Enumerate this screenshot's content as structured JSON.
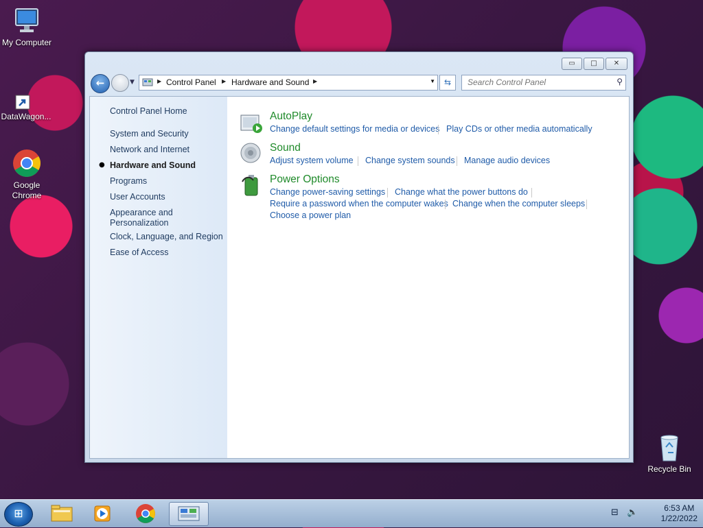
{
  "desktop": {
    "icons": [
      {
        "label": "My Computer"
      },
      {
        "label": "DataWagon..."
      },
      {
        "label": "Google Chrome"
      },
      {
        "label": "Recycle Bin"
      }
    ]
  },
  "window": {
    "controls": {
      "minimize": "▭",
      "maximize": "□",
      "close": "✕"
    },
    "address": {
      "crumbs": [
        "Control Panel",
        "Hardware and Sound"
      ]
    },
    "search_placeholder": "Search Control Panel",
    "sidebar": {
      "home": "Control Panel Home",
      "items": [
        "System and Security",
        "Network and Internet",
        "Hardware and Sound",
        "Programs",
        "User Accounts",
        "Appearance and Personalization",
        "Clock, Language, and Region",
        "Ease of Access"
      ],
      "active_index": 2
    },
    "categories": [
      {
        "title": "AutoPlay",
        "icon": "autoplay-icon",
        "links": [
          [
            "Change default settings for media or devices",
            "Play CDs or other media automatically"
          ]
        ]
      },
      {
        "title": "Sound",
        "icon": "speaker-icon",
        "links": [
          [
            "Adjust system volume",
            "Change system sounds",
            "Manage audio devices"
          ]
        ]
      },
      {
        "title": "Power Options",
        "icon": "battery-icon",
        "links": [
          [
            "Change power-saving settings",
            "Change what the power buttons do"
          ],
          [
            "Require a password when the computer wakes",
            "Change when the computer sleeps"
          ],
          [
            "Choose a power plan"
          ]
        ]
      }
    ]
  },
  "taskbar": {
    "clock": {
      "time": "6:53 AM",
      "date": "1/22/2022"
    },
    "pinned": [
      "explorer-icon",
      "media-player-icon",
      "chrome-icon",
      "control-panel-icon"
    ]
  }
}
